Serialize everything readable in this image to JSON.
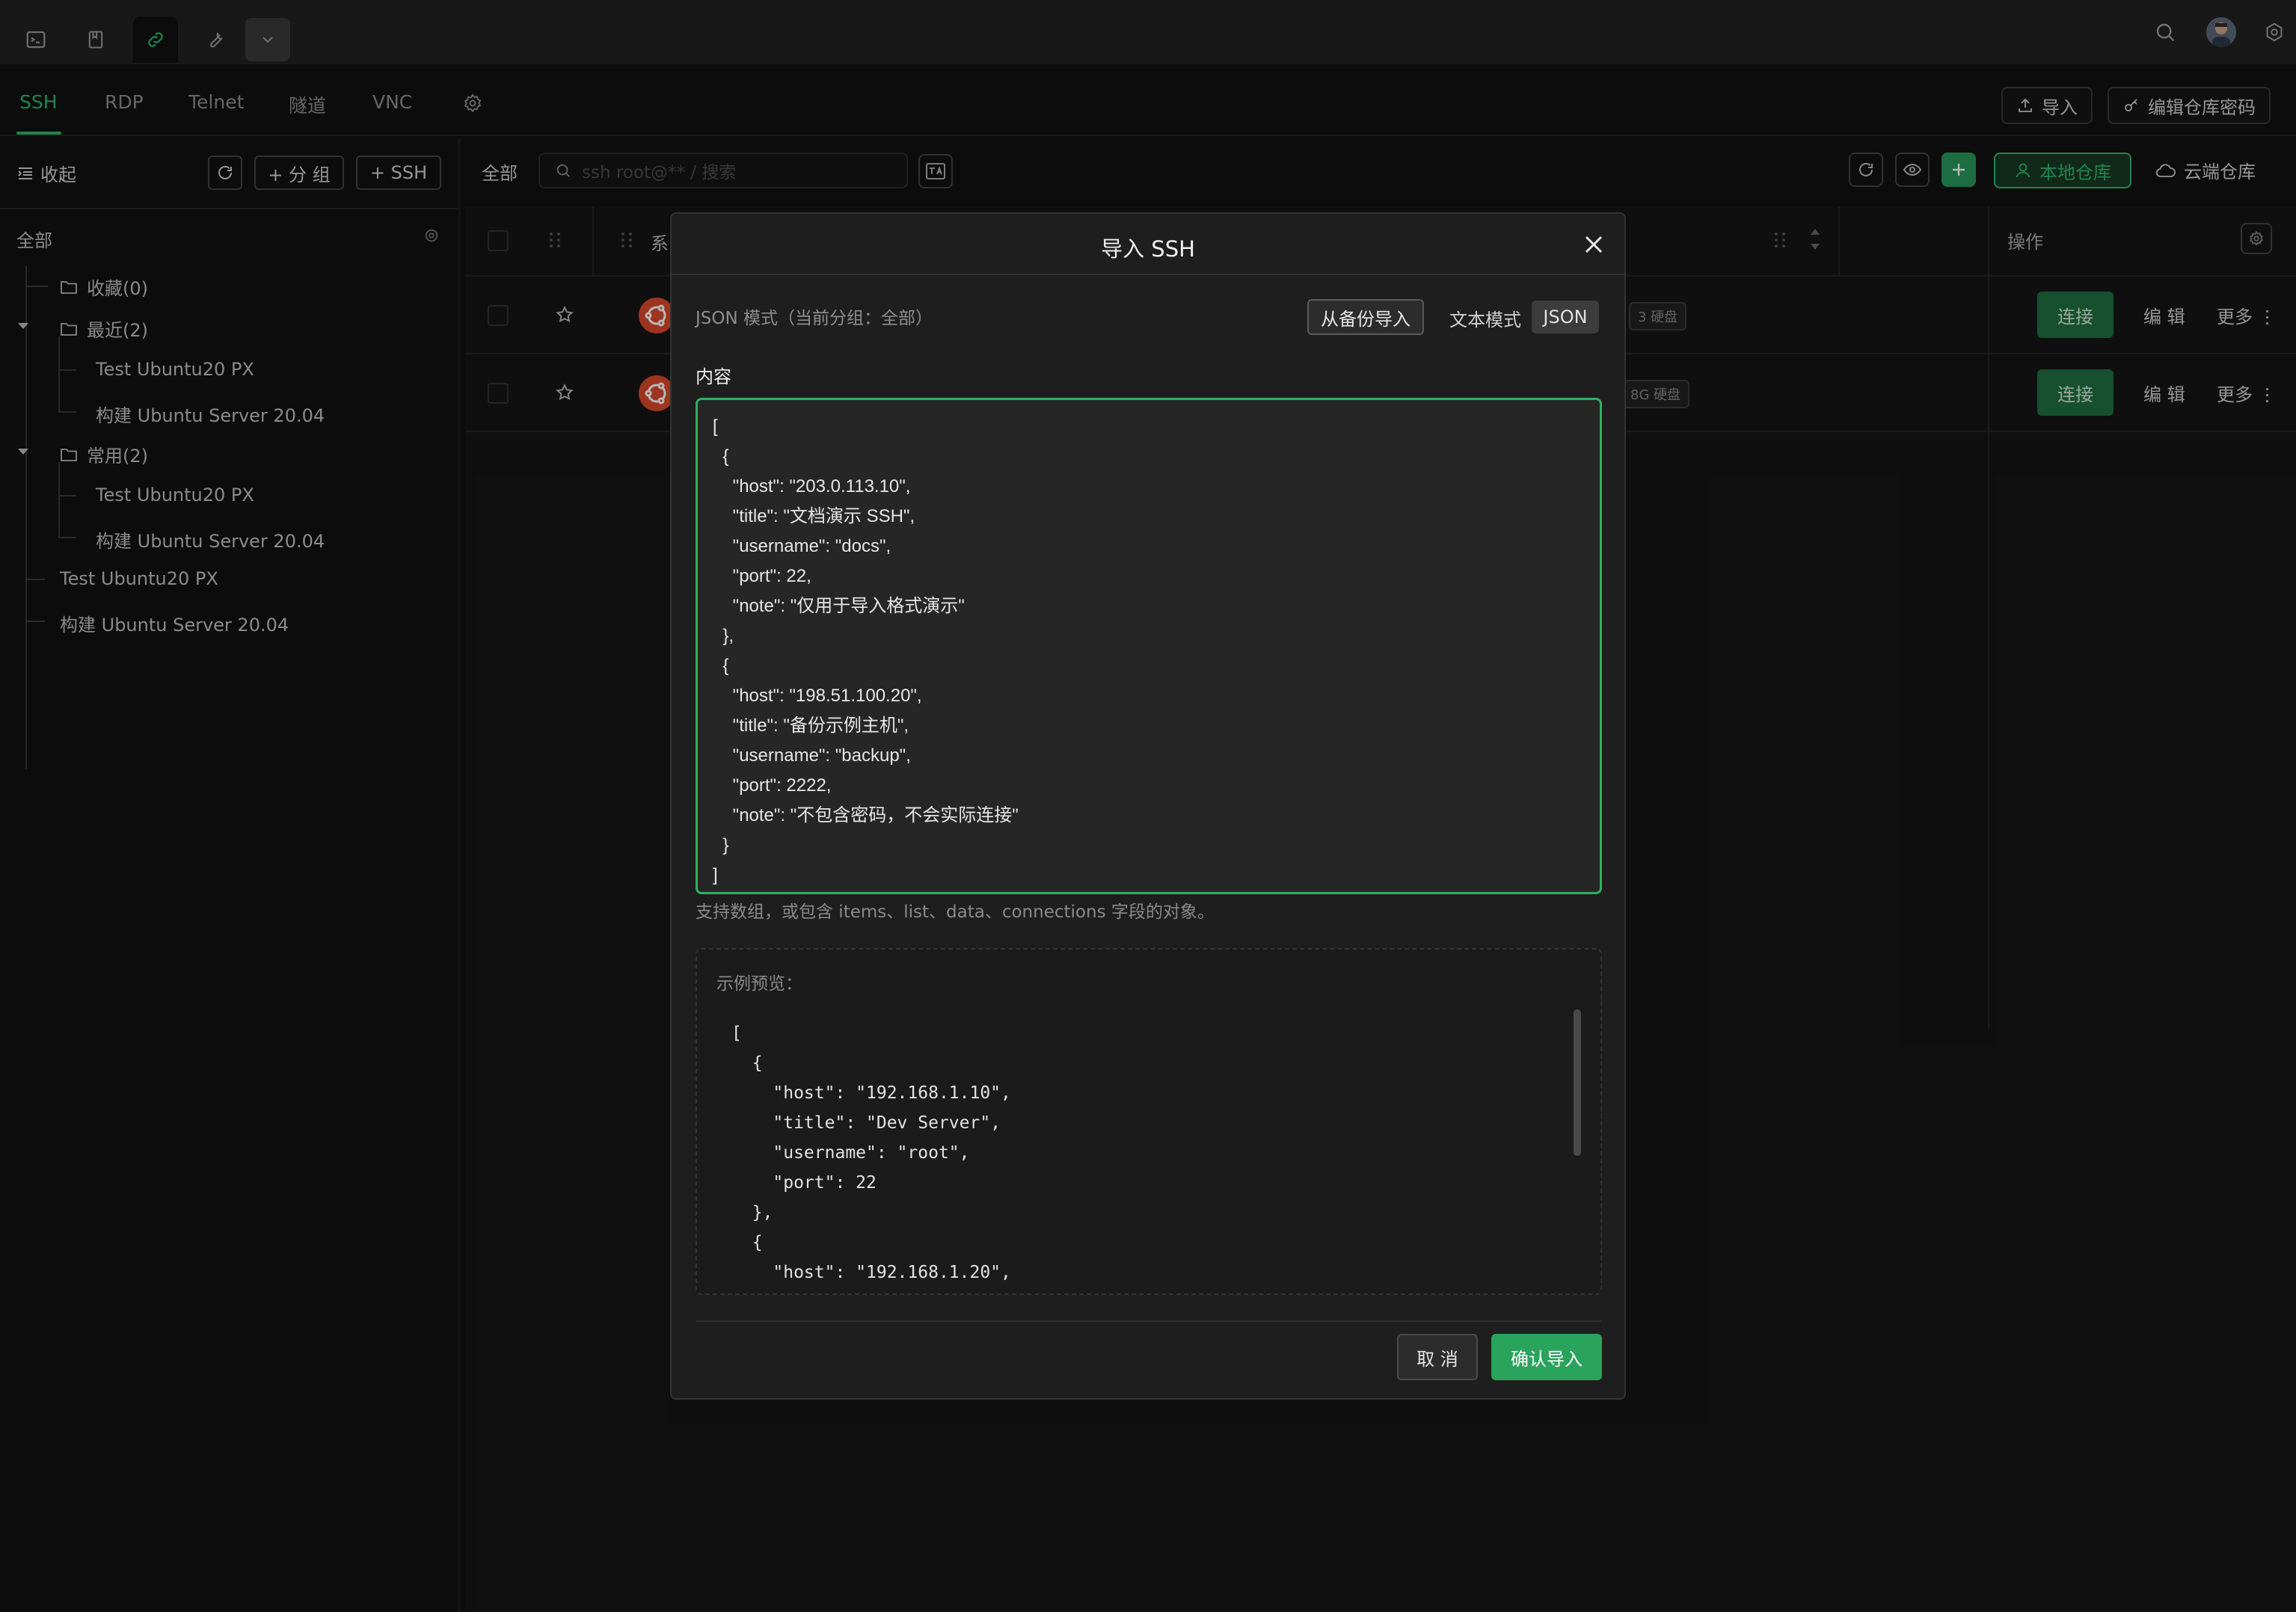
{
  "colors": {
    "accent": "#2fb96e",
    "modal_bg": "#1e1e1e",
    "connect_bg": "#1f6f41"
  },
  "topbar": {
    "icons": [
      "terminal-icon",
      "bookmark-icon",
      "link-icon",
      "wrench-icon",
      "chevron-down-icon"
    ],
    "right_icons": [
      "search-icon",
      "avatar",
      "settings-icon"
    ]
  },
  "tabs": [
    "SSH",
    "RDP",
    "Telnet",
    "隧道",
    "VNC"
  ],
  "header_actions": {
    "import": "导入",
    "edit_password": "编辑仓库密码"
  },
  "sidebar": {
    "collapse": "收起",
    "add_group": "+ 分 组",
    "add_ssh": "+ SSH",
    "all": "全部",
    "tree": {
      "favorites": "收藏(0)",
      "recent": "最近(2)",
      "recent_items": [
        "Test Ubuntu20 PX",
        "构建 Ubuntu Server 20.04"
      ],
      "common": "常用(2)",
      "common_items": [
        "Test Ubuntu20 PX",
        "构建 Ubuntu Server 20.04"
      ],
      "loose_items": [
        "Test Ubuntu20 PX",
        "构建 Ubuntu Server 20.04"
      ]
    }
  },
  "main": {
    "filter_label": "全部",
    "search_placeholder": "ssh root@** / 搜索",
    "local_repo": "本地仓库",
    "cloud_repo": "云端仓库",
    "table": {
      "col_system": "系",
      "col_ops": "操作",
      "rows": [
        {
          "disk": "3 硬盘",
          "connect": "连接",
          "edit": "编 辑",
          "more": "更多"
        },
        {
          "disk": "8G 硬盘",
          "connect": "连接",
          "edit": "编 辑",
          "more": "更多"
        }
      ]
    }
  },
  "modal": {
    "title": "导入 SSH",
    "mode_label": "JSON 模式（当前分组：全部）",
    "from_backup": "从备份导入",
    "text_mode": "文本模式",
    "json_mode": "JSON",
    "content_label": "内容",
    "content": "[\n  {\n    \"host\": \"203.0.113.10\",\n    \"title\": \"文档演示 SSH\",\n    \"username\": \"docs\",\n    \"port\": 22,\n    \"note\": \"仅用于导入格式演示\"\n  },\n  {\n    \"host\": \"198.51.100.20\",\n    \"title\": \"备份示例主机\",\n    \"username\": \"backup\",\n    \"port\": 2222,\n    \"note\": \"不包含密码，不会实际连接\"\n  }\n]",
    "hint": "支持数组，或包含 items、list、data、connections 字段的对象。",
    "preview_label": "示例预览：",
    "preview_code": "[\n  {\n    \"host\": \"192.168.1.10\",\n    \"title\": \"Dev Server\",\n    \"username\": \"root\",\n    \"port\": 22\n  },\n  {\n    \"host\": \"192.168.1.20\",",
    "cancel": "取 消",
    "confirm": "确认导入"
  }
}
